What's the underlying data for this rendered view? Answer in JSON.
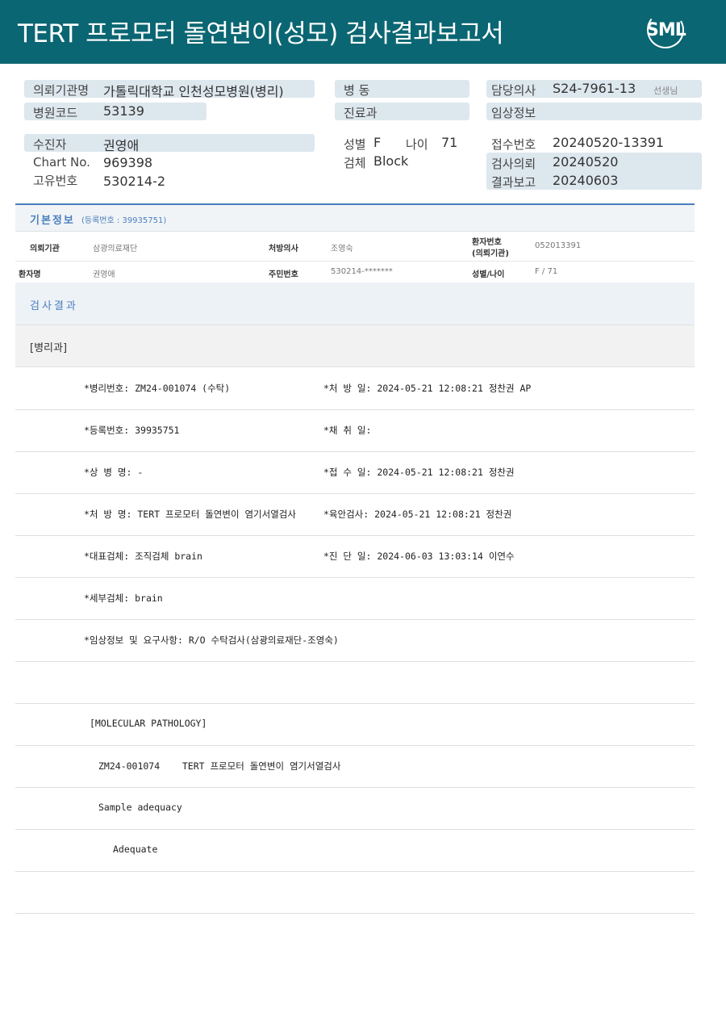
{
  "header": {
    "title": "TERT 프로모터 돌연변이(성모) 검사결과보고서",
    "logo_text": "SML"
  },
  "info": {
    "institution_label": "의뢰기관명",
    "institution": "가톨릭대학교 인천성모병원(병리)",
    "hospital_code_label": "병원코드",
    "hospital_code": "53139",
    "ward_label": "병  동",
    "dept_label": "진료과",
    "doctor_label": "담당의사",
    "doctor_value": "S24-7961-13",
    "doctor_note": "선생님",
    "clinical_label": "임상정보",
    "patient_label": "수진자",
    "patient": "권영애",
    "chart_label": "Chart No.",
    "chart": "969398",
    "id_label": "고유번호",
    "id": "530214-2",
    "sex_label": "성별",
    "sex": "F",
    "age_label": "나이",
    "age": "71",
    "specimen_label": "검체",
    "specimen": "Block",
    "receipt_label": "접수번호",
    "receipt": "20240520-13391",
    "request_label": "검사의뢰",
    "request": "20240520",
    "report_label": "결과보고",
    "report": "20240603"
  },
  "basic": {
    "title": "기본정보",
    "sub": "(등록번호 : 39935751)",
    "r1": {
      "l1": "의뢰기관",
      "v1": "삼광의료재단",
      "l2": "처방의사",
      "v2": "조영숙",
      "l3a": "환자번호",
      "l3b": "(의뢰기관)",
      "v3": "052013391"
    },
    "r2": {
      "l1": "환자명",
      "v1": "권영애",
      "l2": "주민번호",
      "v2": "530214-*******",
      "l3": "성별/나이",
      "v3": "F / 71"
    }
  },
  "result": {
    "title": "검사결과",
    "dept": "[병리과]",
    "lines": {
      "l1a": "*병리번호: ZM24-001074 (수탁)",
      "l1b": "*처 방 일: 2024-05-21 12:08:21  정찬권 AP",
      "l2a": "*등록번호: 39935751",
      "l2b": "*채 취 일:",
      "l3a": "*상 병 명: -",
      "l3b": "*접 수 일: 2024-05-21 12:08:21  정찬권",
      "l4a": "*처 방 명: TERT 프로모터 돌연변이 염기서열검사",
      "l4b": "*육안검사: 2024-05-21 12:08:21  정찬권",
      "l5a": "*대표검체: 조직검체 brain",
      "l5b": "*진 단 일: 2024-06-03 13:03:14  이연수",
      "l6a": "*세부검체: brain",
      "l7a": "*임상정보 및 요구사항: R/O 수탁검사(삼광의료재단-조영숙)",
      "l9a": "[MOLECULAR PATHOLOGY]",
      "l10a": "ZM24-001074    TERT 프로모터 돌연변이 염기서열검사",
      "l11a": "Sample adequacy",
      "l12a": "Adequate"
    }
  }
}
